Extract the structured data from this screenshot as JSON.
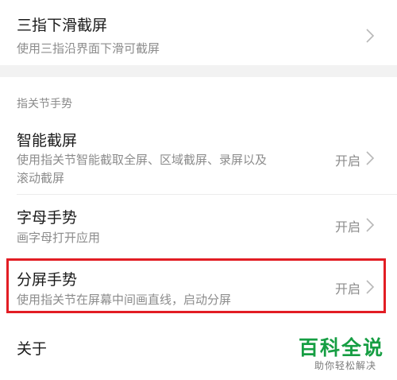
{
  "settings": {
    "three_finger": {
      "title": "三指下滑截屏",
      "subtitle": "使用三指沿界面下滑可截屏"
    },
    "knuckle_section": {
      "header": "指关节手势",
      "items": [
        {
          "title": "智能截屏",
          "subtitle_line1": "使用指关节智能截取全屏、区域截屏、录屏以及",
          "subtitle_line2": "滚动截屏",
          "value": "开启"
        },
        {
          "title": "字母手势",
          "subtitle_line1": "画字母打开应用",
          "value": "开启"
        },
        {
          "title": "分屏手势",
          "subtitle_line1": "使用指关节在屏幕中间画直线，启动分屏",
          "value": "开启"
        }
      ]
    },
    "about": {
      "title": "关于"
    }
  },
  "watermark": {
    "title": "百科全说",
    "subtitle": "助你轻松解决"
  },
  "colors": {
    "highlight_border": "#e21d24",
    "watermark_green": "#169e43",
    "background": "#f2f2f2",
    "card": "#ffffff"
  }
}
